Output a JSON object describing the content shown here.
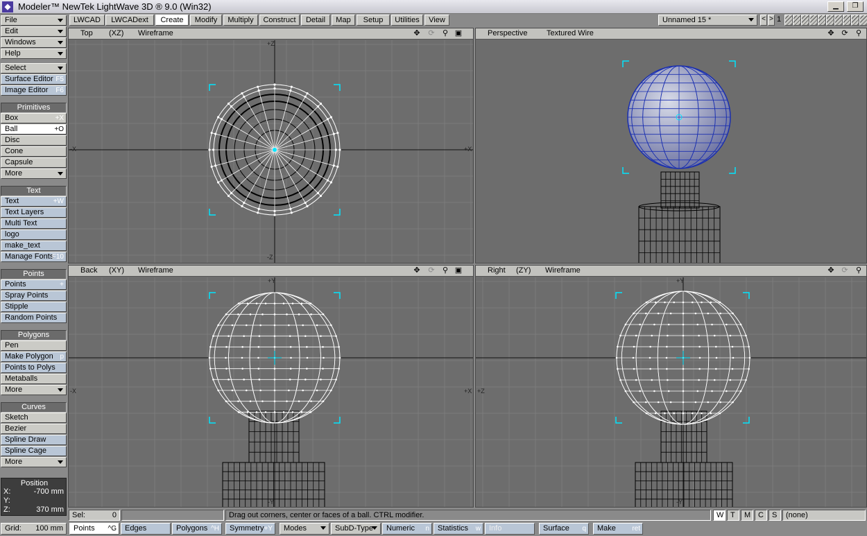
{
  "window": {
    "title": "Modeler™ NewTek LightWave 3D ® 9.0 (Win32)",
    "icon": "lightwave-logo-icon",
    "min": "▁",
    "restore": "❐"
  },
  "menu": [
    {
      "label": "File"
    },
    {
      "label": "Edit"
    },
    {
      "label": "Windows"
    },
    {
      "label": "Help"
    }
  ],
  "select": {
    "label": "Select"
  },
  "editors": [
    {
      "label": "Surface Editor",
      "key": "F5"
    },
    {
      "label": "Image Editor",
      "key": "F6"
    }
  ],
  "groups": {
    "primitives": {
      "title": "Primitives",
      "items": [
        {
          "label": "Box",
          "key": "+X"
        },
        {
          "label": "Ball",
          "key": "+O"
        },
        {
          "label": "Disc",
          "key": ""
        },
        {
          "label": "Cone",
          "key": ""
        },
        {
          "label": "Capsule",
          "key": ""
        },
        {
          "label": "More",
          "key": ""
        }
      ]
    },
    "text": {
      "title": "Text",
      "items": [
        {
          "label": "Text",
          "key": "+W"
        },
        {
          "label": "Text Layers",
          "key": ""
        },
        {
          "label": "Multi Text",
          "key": ""
        },
        {
          "label": "logo",
          "key": ""
        },
        {
          "label": "make_text",
          "key": ""
        },
        {
          "label": "Manage Fonts",
          "key": "F10"
        }
      ]
    },
    "points": {
      "title": "Points",
      "items": [
        {
          "label": "Points",
          "key": "+"
        },
        {
          "label": "Spray Points",
          "key": ""
        },
        {
          "label": "Stipple",
          "key": ""
        },
        {
          "label": "Random Points",
          "key": ""
        }
      ]
    },
    "polygons": {
      "title": "Polygons",
      "items": [
        {
          "label": "Pen",
          "key": ""
        },
        {
          "label": "Make Polygon",
          "key": "p"
        },
        {
          "label": "Points to Polys",
          "key": ""
        },
        {
          "label": "Metaballs",
          "key": ""
        },
        {
          "label": "More",
          "key": ""
        }
      ]
    },
    "curves": {
      "title": "Curves",
      "items": [
        {
          "label": "Sketch",
          "key": ""
        },
        {
          "label": "Bezier",
          "key": ""
        },
        {
          "label": "Spline Draw",
          "key": ""
        },
        {
          "label": "Spline Cage",
          "key": ""
        },
        {
          "label": "More",
          "key": ""
        }
      ]
    }
  },
  "position": {
    "title": "Position",
    "x_label": "X:",
    "x": "-700 mm",
    "y_label": "Y:",
    "y": "",
    "z_label": "Z:",
    "z": "370 mm"
  },
  "tabs": [
    "LWCAD",
    "LWCADext",
    "Create",
    "Modify",
    "Multiply",
    "Construct",
    "Detail",
    "Map",
    "Setup",
    "Utilities",
    "View"
  ],
  "active_tab": "Create",
  "object": {
    "name": "Unnamed 15 *",
    "layer": "1",
    "prev": "<",
    "next": ">"
  },
  "viewports": {
    "top": {
      "view": "Top",
      "axes": "(XZ)",
      "mode": "Wireframe",
      "label_top": "+Z",
      "label_bottom": "-Z",
      "label_left": "-X",
      "label_right": "+X"
    },
    "perspective": {
      "view": "Perspective",
      "mode": "Textured Wire"
    },
    "back": {
      "view": "Back",
      "axes": "(XY)",
      "mode": "Wireframe",
      "label_top": "+Y",
      "label_bottom": "-Y",
      "label_left": "-X",
      "label_right": "+X"
    },
    "right": {
      "view": "Right",
      "axes": "(ZY)",
      "mode": "Wireframe",
      "label_top": "+Y",
      "label_bottom": "-Y",
      "label_left": "+Z",
      "label_right": ""
    }
  },
  "status": {
    "sel_label": "Sel:",
    "sel_count": "0",
    "hint": "Drag out corners, center or faces of a ball. CTRL modifier.",
    "modes": [
      "W",
      "T",
      "M",
      "C",
      "S"
    ],
    "surface": "(none)"
  },
  "bottom": {
    "grid_label": "Grid:",
    "grid": "100 mm",
    "points": "Points",
    "points_key": "^G",
    "edges": "Edges",
    "polygons": "Polygons",
    "polygons_key": "^H",
    "symmetry": "Symmetry",
    "symmetry_key": "+Y",
    "modes": "Modes",
    "subd": "SubD-Type",
    "numeric": "Numeric",
    "numeric_key": "n",
    "statistics": "Statistics",
    "statistics_key": "w",
    "info": "Info",
    "surface": "Surface",
    "surface_key": "q",
    "make": "Make",
    "make_key": "ret"
  },
  "colors": {
    "viewport_bg": "#6d6d6d",
    "grid": "#7c7c7c",
    "wire": "#ffffff",
    "selection": "#00e5ff",
    "sphere_fill": "#aab0c8",
    "sphere_edge": "#1a2fb0"
  }
}
